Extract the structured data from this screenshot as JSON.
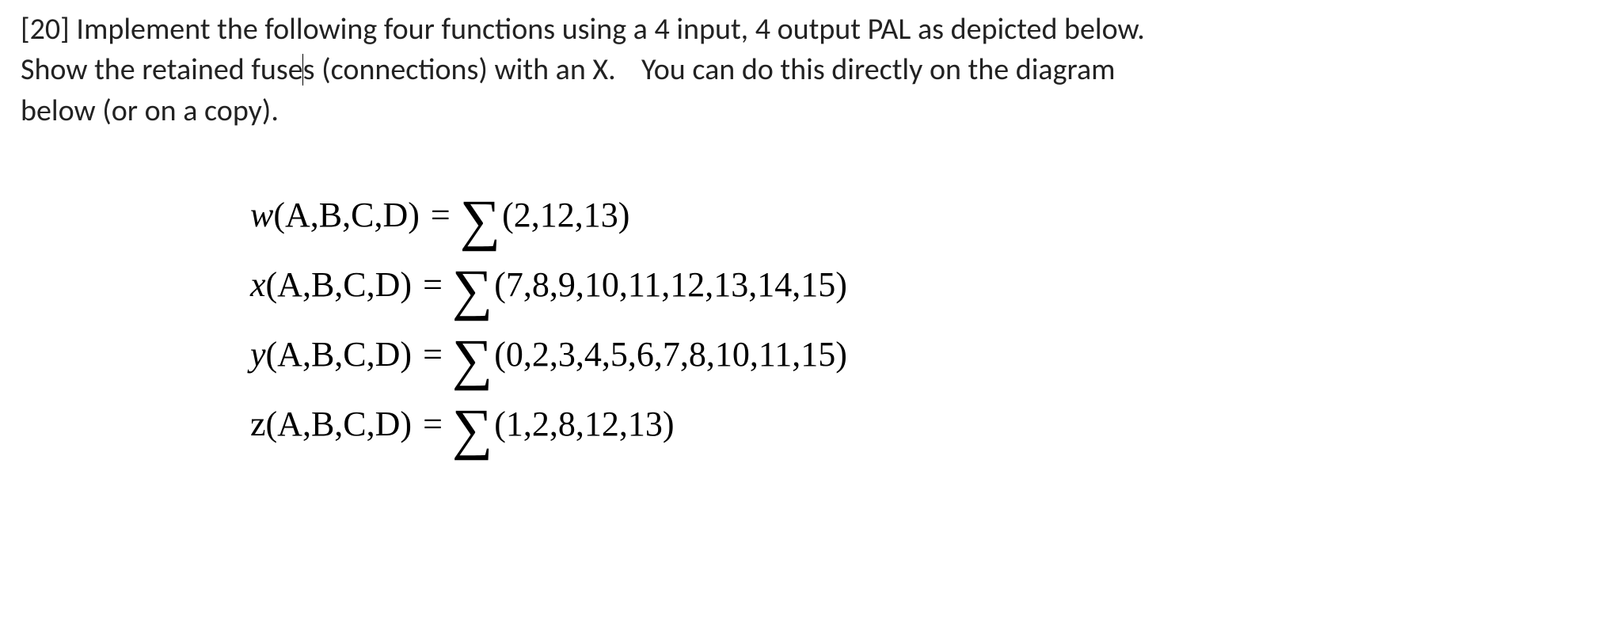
{
  "problem": {
    "points": "[20]",
    "line1_a": " Implement the following four functions using a 4 input, 4 output PAL as depicted below.",
    "line2_a": "Show the retained fuse",
    "line2_b": "s (connections) with an X.",
    "line2_c": "You can do this directly on the diagram",
    "line3": "below (or on a copy)."
  },
  "sigma": "∑",
  "functions": [
    {
      "name_style": "italic",
      "name": "w",
      "args": "(A,B,C,D)",
      "eq": "=",
      "minterms": "(2,12,13)"
    },
    {
      "name_style": "italic",
      "name": "x",
      "args": "(A,B,C,D)",
      "eq": "=",
      "minterms": "(7,8,9,10,11,12,13,14,15)"
    },
    {
      "name_style": "italic",
      "name": "y",
      "args": "(A,B,C,D)",
      "eq": "=",
      "minterms": "(0,2,3,4,5,6,7,8,10,11,15)"
    },
    {
      "name_style": "roman",
      "name": "z",
      "args": "(A,B,C,D)",
      "eq": "=",
      "minterms": "(1,2,8,12,13)"
    }
  ]
}
